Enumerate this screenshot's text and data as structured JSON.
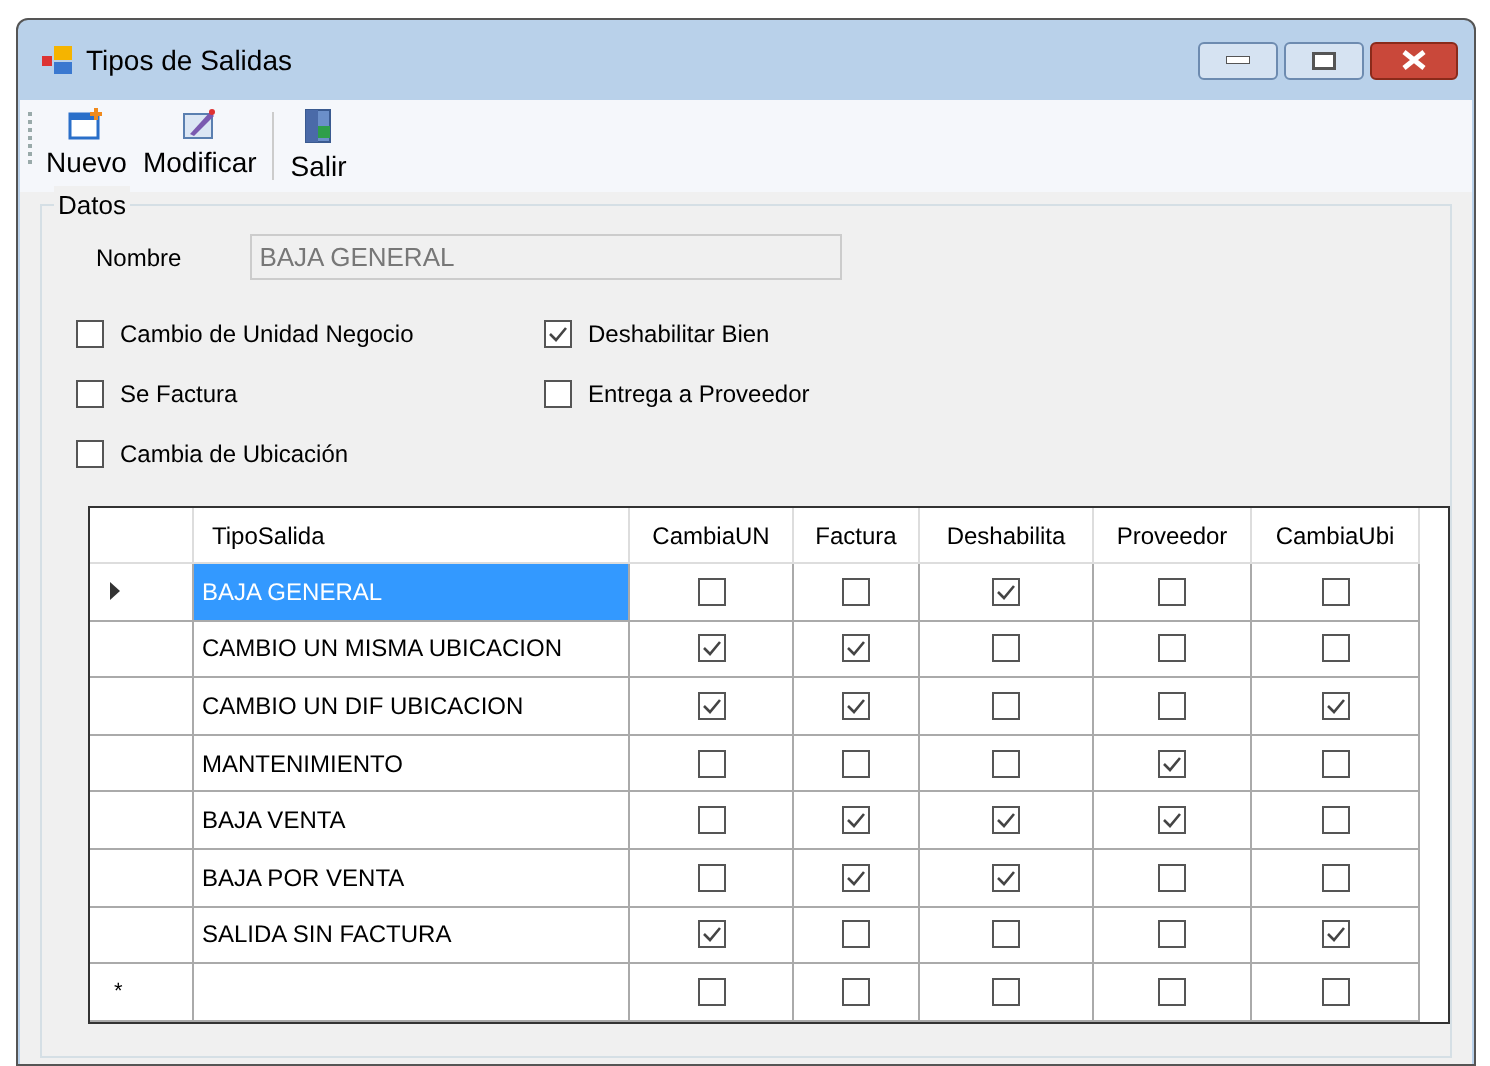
{
  "window": {
    "title": "Tipos de Salidas"
  },
  "toolbar": [
    {
      "label": "Nuevo",
      "kind": "new"
    },
    {
      "label": "Modificar",
      "kind": "edit"
    },
    {
      "label": "Salir",
      "kind": "exit"
    }
  ],
  "group": {
    "title": "Datos",
    "name_label": "Nombre",
    "name_value": "BAJA GENERAL",
    "checkboxes": [
      {
        "label": "Cambio de Unidad Negocio",
        "checked": false
      },
      {
        "label": "Deshabilitar Bien",
        "checked": true
      },
      {
        "label": "Se Factura",
        "checked": false
      },
      {
        "label": "Entrega a Proveedor",
        "checked": false
      },
      {
        "label": "Cambia de Ubicación",
        "checked": false
      }
    ]
  },
  "table": {
    "columns": [
      "TipoSalida",
      "CambiaUN",
      "Factura",
      "Deshabilita",
      "Proveedor",
      "CambiaUbi"
    ],
    "rows": [
      {
        "kind": "data",
        "selected": true,
        "name": "BAJA GENERAL",
        "flags": [
          false,
          false,
          true,
          false,
          false
        ]
      },
      {
        "kind": "data",
        "selected": false,
        "name": "CAMBIO UN MISMA UBICACION",
        "flags": [
          true,
          true,
          false,
          false,
          false
        ]
      },
      {
        "kind": "data",
        "selected": false,
        "name": "CAMBIO UN DIF UBICACION",
        "flags": [
          true,
          true,
          false,
          false,
          true
        ]
      },
      {
        "kind": "data",
        "selected": false,
        "name": "MANTENIMIENTO",
        "flags": [
          false,
          false,
          false,
          true,
          false
        ]
      },
      {
        "kind": "data",
        "selected": false,
        "name": "BAJA VENTA",
        "flags": [
          false,
          true,
          true,
          true,
          false
        ]
      },
      {
        "kind": "data",
        "selected": false,
        "name": "BAJA POR VENTA",
        "flags": [
          false,
          true,
          true,
          false,
          false
        ]
      },
      {
        "kind": "data",
        "selected": false,
        "name": "SALIDA SIN FACTURA",
        "flags": [
          true,
          false,
          false,
          false,
          true
        ]
      },
      {
        "kind": "new",
        "selected": false,
        "marker": "*",
        "flags": [
          false,
          false,
          false,
          false,
          false
        ]
      }
    ]
  }
}
